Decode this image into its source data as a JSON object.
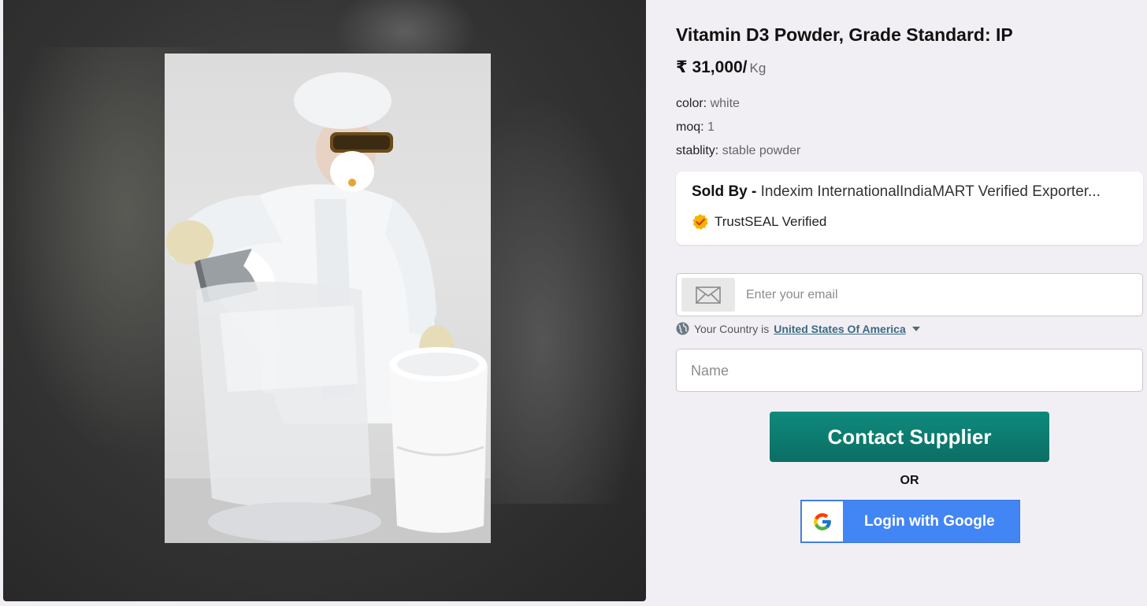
{
  "product": {
    "title": "Vitamin D3 Powder, Grade Standard: IP",
    "price": "₹ 31,000/",
    "unit": "Kg",
    "specs": [
      {
        "key": "color:",
        "value": "white"
      },
      {
        "key": "moq:",
        "value": "1"
      },
      {
        "key": "stablity:",
        "value": "stable powder"
      }
    ]
  },
  "seller": {
    "sold_by_label": "Sold By -",
    "name": "Indexim InternationalIndiaMART Verified Exporter...",
    "trust_label": "TrustSEAL Verified",
    "trust_icon": "trustseal-badge-icon"
  },
  "form": {
    "email_placeholder": "Enter your email",
    "email_icon": "envelope-icon",
    "country_prefix": "Your Country is",
    "country": "United States Of America",
    "name_placeholder": "Name",
    "contact_button": "Contact Supplier",
    "or_label": "OR",
    "google_button": "Login with Google"
  },
  "colors": {
    "contact_button": "#0b7a6e",
    "google_button": "#4285f4",
    "page_background": "#f2eff4"
  }
}
